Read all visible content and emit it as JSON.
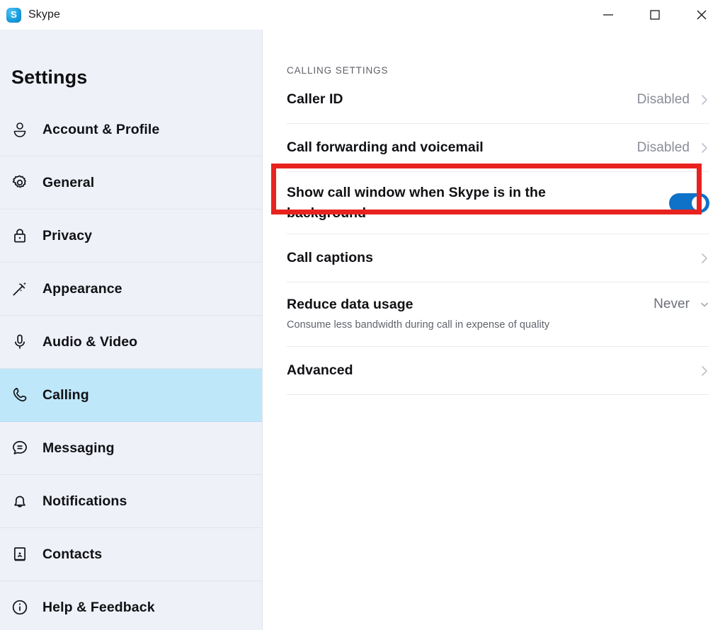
{
  "window": {
    "app_name": "Skype",
    "logo_letter": "S",
    "controls": [
      {
        "name": "minimize",
        "label": "Minimize"
      },
      {
        "name": "maximize",
        "label": "Maximize"
      },
      {
        "name": "close",
        "label": "Close"
      }
    ]
  },
  "sidebar": {
    "heading": "Settings",
    "items": [
      {
        "label": "Account & Profile",
        "icon": "person-icon",
        "selected": false
      },
      {
        "label": "General",
        "icon": "gear-icon",
        "selected": false
      },
      {
        "label": "Privacy",
        "icon": "lock-icon",
        "selected": false
      },
      {
        "label": "Appearance",
        "icon": "magic-wand-icon",
        "selected": false
      },
      {
        "label": "Audio & Video",
        "icon": "microphone-icon",
        "selected": false
      },
      {
        "label": "Calling",
        "icon": "phone-icon",
        "selected": true
      },
      {
        "label": "Messaging",
        "icon": "chat-bubble-icon",
        "selected": false
      },
      {
        "label": "Notifications",
        "icon": "bell-icon",
        "selected": false
      },
      {
        "label": "Contacts",
        "icon": "contact-book-icon",
        "selected": false
      },
      {
        "label": "Help & Feedback",
        "icon": "info-circle-icon",
        "selected": false
      }
    ]
  },
  "main": {
    "section_title": "CALLING SETTINGS",
    "rows": {
      "caller_id": {
        "label": "Caller ID",
        "value": "Disabled"
      },
      "call_forwarding": {
        "label": "Call forwarding and voicemail",
        "value": "Disabled"
      },
      "show_call_window": {
        "label": "Show call window when Skype is in the background",
        "toggle_on": true
      },
      "call_captions": {
        "label": "Call captions"
      },
      "reduce_data_usage": {
        "label": "Reduce data usage",
        "value": "Never",
        "description": "Consume less bandwidth during call in expense of quality"
      },
      "advanced": {
        "label": "Advanced"
      }
    }
  },
  "annotation": {
    "color": "#e8231f",
    "target": "Call forwarding and voicemail"
  },
  "colors": {
    "sidebar_bg": "#eff1f8",
    "selected_item_bg": "#bfe7fa",
    "toggle_on": "#0e72c9",
    "accent_red": "#e8231f",
    "text_primary": "#101114",
    "text_muted": "#8a8d96"
  }
}
